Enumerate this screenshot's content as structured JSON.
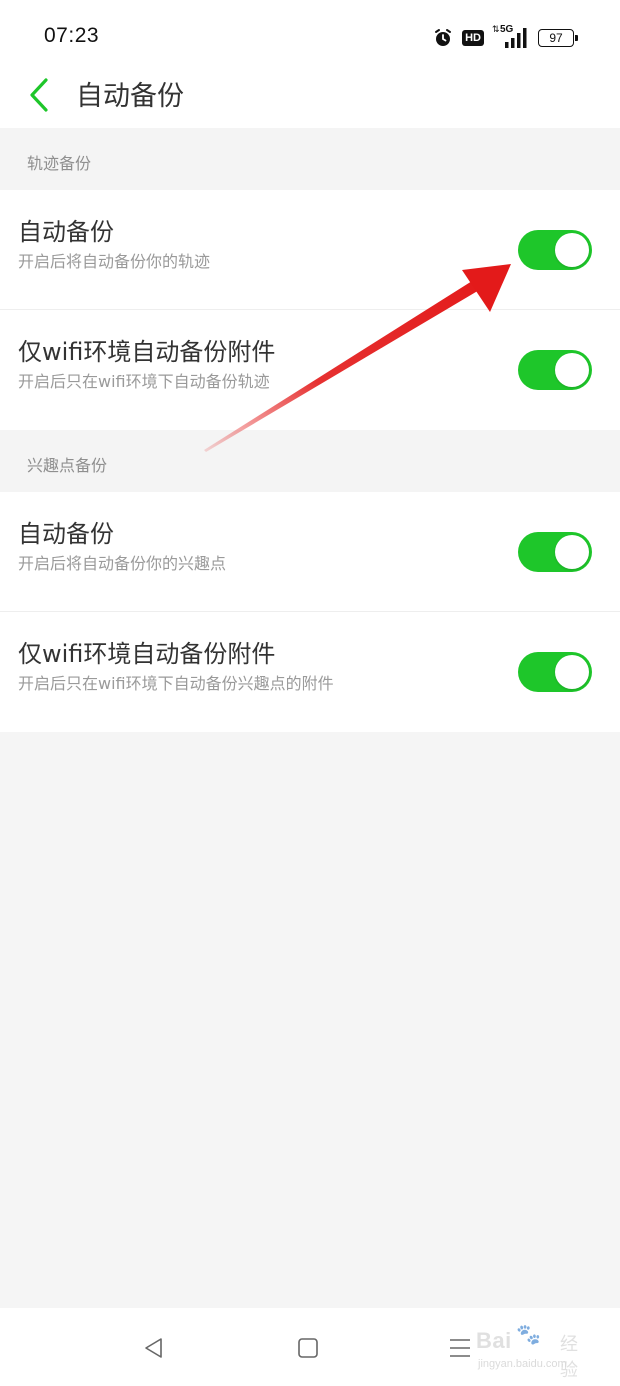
{
  "status_bar": {
    "time": "07:23",
    "hd": "HD",
    "network": "5G",
    "battery": "97"
  },
  "header": {
    "title": "自动备份"
  },
  "sections": [
    {
      "title": "轨迹备份",
      "rows": [
        {
          "title": "自动备份",
          "subtitle": "开启后将自动备份你的轨迹",
          "enabled": true
        },
        {
          "title": "仅wifi环境自动备份附件",
          "subtitle": "开启后只在wifi环境下自动备份轨迹",
          "enabled": true
        }
      ]
    },
    {
      "title": "兴趣点备份",
      "rows": [
        {
          "title": "自动备份",
          "subtitle": "开启后将自动备份你的兴趣点",
          "enabled": true
        },
        {
          "title": "仅wifi环境自动备份附件",
          "subtitle": "开启后只在wifi环境下自动备份兴趣点的附件",
          "enabled": true
        }
      ]
    }
  ],
  "nav_bar": {
    "buttons": [
      "back-icon",
      "home-icon",
      "menu-icon"
    ]
  },
  "watermark": {
    "brand": "Bai",
    "brand_cn": "经验",
    "url": "jingyan.baidu.com"
  },
  "colors": {
    "accent": "#1ec62a",
    "toggle_on": "#1ec62a",
    "annotation_arrow": "#e31a1a"
  }
}
